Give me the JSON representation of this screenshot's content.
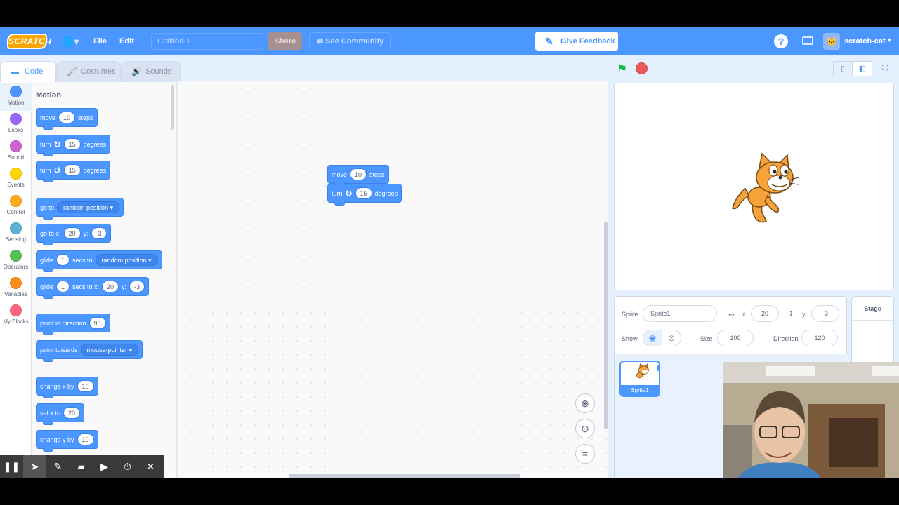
{
  "menu": {
    "logo": "SCRATCH",
    "file": "File",
    "edit": "Edit",
    "project_title": "Untitled-1",
    "share": "Share",
    "see_community": "See Community",
    "give_feedback": "Give Feedback",
    "username": "scratch-cat"
  },
  "tabs": {
    "code": "Code",
    "costumes": "Costumes",
    "sounds": "Sounds"
  },
  "categories": [
    {
      "label": "Motion",
      "color": "#4c97ff"
    },
    {
      "label": "Looks",
      "color": "#9966ff"
    },
    {
      "label": "Sound",
      "color": "#cf63cf"
    },
    {
      "label": "Events",
      "color": "#ffd500"
    },
    {
      "label": "Control",
      "color": "#ffab19"
    },
    {
      "label": "Sensing",
      "color": "#5cb1d6"
    },
    {
      "label": "Operators",
      "color": "#59c059"
    },
    {
      "label": "Variables",
      "color": "#ff8c1a"
    },
    {
      "label": "My Blocks",
      "color": "#ff6680"
    }
  ],
  "palette": {
    "title": "Motion",
    "move": {
      "pre": "move",
      "val": "10",
      "post": "steps"
    },
    "turn_right": {
      "pre": "turn",
      "val": "15",
      "post": "degrees"
    },
    "turn_left": {
      "pre": "turn",
      "val": "15",
      "post": "degrees"
    },
    "goto": {
      "pre": "go to",
      "drop": "random position"
    },
    "goto_xy": {
      "pre": "go to x:",
      "x": "20",
      "ylbl": "y:",
      "y": "-3"
    },
    "glide_to": {
      "pre": "glide",
      "val": "1",
      "mid": "secs to",
      "drop": "random position"
    },
    "glide_xy": {
      "pre": "glide",
      "val": "1",
      "mid": "secs to x:",
      "x": "20",
      "ylbl": "y:",
      "y": "-3"
    },
    "point_dir": {
      "pre": "point in direction",
      "val": "90"
    },
    "point_towards": {
      "pre": "point towards",
      "drop": "mouse-pointer"
    },
    "change_x": {
      "pre": "change x by",
      "val": "10"
    },
    "set_x": {
      "pre": "set x to",
      "val": "20"
    },
    "change_y": {
      "pre": "change y by",
      "val": "10"
    }
  },
  "script": {
    "move": {
      "pre": "move",
      "val": "10",
      "post": "steps"
    },
    "turn": {
      "pre": "turn",
      "val": "15",
      "post": "degrees"
    }
  },
  "sprite_info": {
    "sprite_label": "Sprite",
    "sprite_name": "Sprite1",
    "x_label": "x",
    "x": "20",
    "y_label": "y",
    "y": "-3",
    "show_label": "Show",
    "size_label": "Size",
    "size": "100",
    "direction_label": "Direction",
    "direction": "120"
  },
  "sprite_list": [
    {
      "name": "Sprite1"
    }
  ],
  "stage_panel": {
    "label": "Stage"
  },
  "icons": {
    "flag": "green-flag-icon",
    "stop": "stop-icon",
    "help": "help-icon",
    "folder": "folder-icon"
  }
}
